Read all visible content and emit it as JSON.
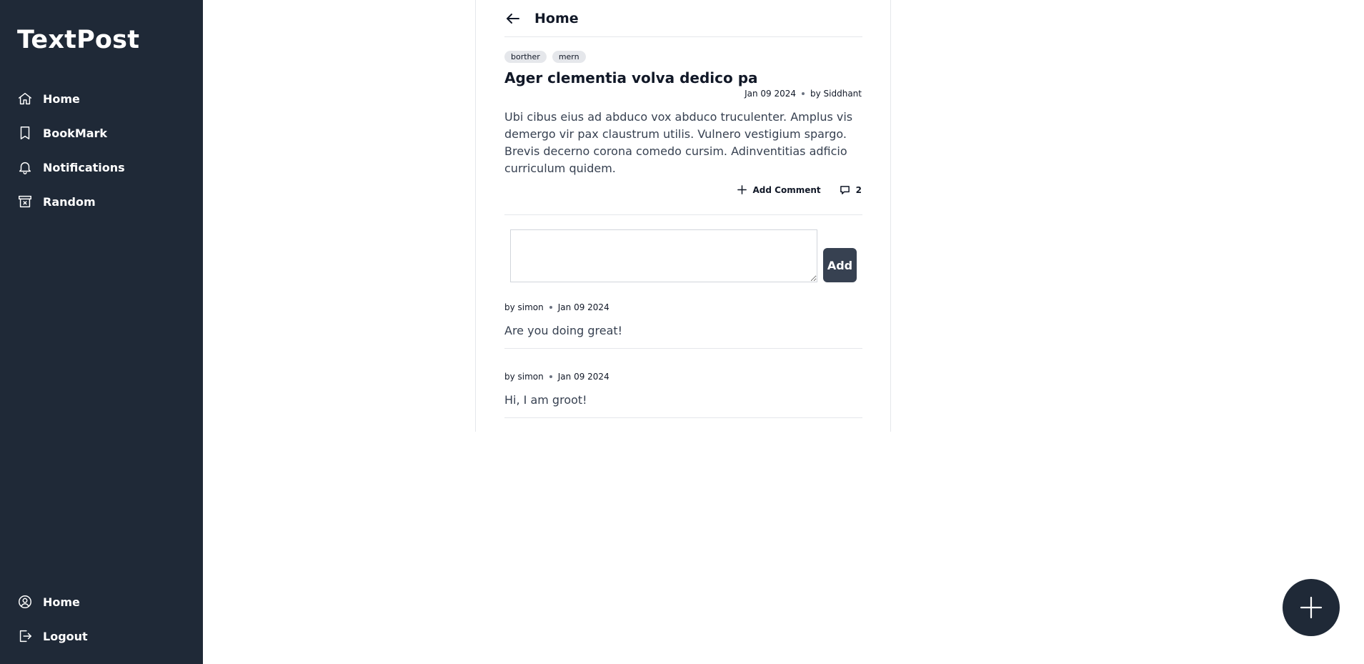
{
  "app": {
    "brand": "TextPost"
  },
  "sidebar": {
    "top_items": [
      {
        "label": "Home",
        "icon": "home-icon"
      },
      {
        "label": "BookMark",
        "icon": "bookmark-icon"
      },
      {
        "label": "Notifications",
        "icon": "bell-icon"
      },
      {
        "label": "Random",
        "icon": "archive-x-icon"
      }
    ],
    "bottom_items": [
      {
        "label": "Home",
        "icon": "user-circle-icon"
      },
      {
        "label": "Logout",
        "icon": "logout-icon"
      }
    ]
  },
  "header": {
    "title": "Home"
  },
  "post": {
    "tags": [
      "borther",
      "mern"
    ],
    "title": "Ager clementia volva dedico pa",
    "date": "Jan 09 2024",
    "author": "by Siddhant",
    "body": "Ubi cibus eius ad abduco vox abduco truculenter. Amplus vis demergo vir pax claustrum utilis. Vulnero vestigium spargo. Brevis decerno corona comedo cursim. Adinventitias adficio curriculum quidem.",
    "add_comment_label": "Add Comment",
    "comment_count": "2"
  },
  "comment_form": {
    "placeholder": "",
    "value": "",
    "button_label": "Add"
  },
  "comments": [
    {
      "author": "by simon",
      "date": "Jan 09 2024",
      "text": "Are you doing great!"
    },
    {
      "author": "by simon",
      "date": "Jan 09 2024",
      "text": "Hi, I am groot!"
    }
  ],
  "colors": {
    "sidebar": "#1f2937",
    "accent": "#374151"
  }
}
